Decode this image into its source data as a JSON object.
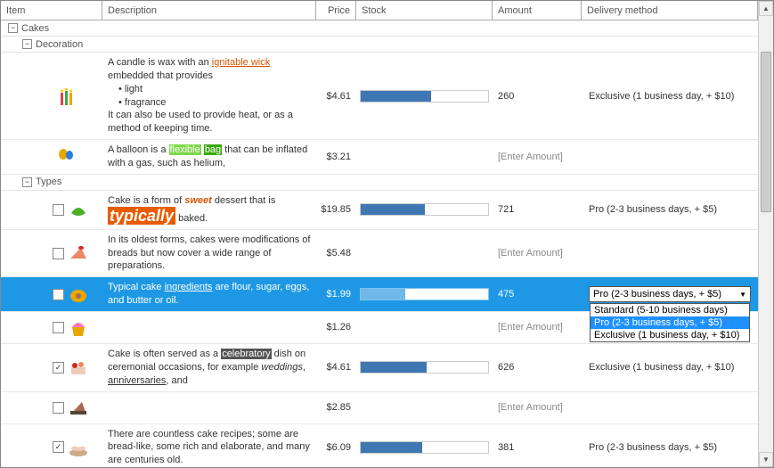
{
  "headers": {
    "item": "Item",
    "desc": "Description",
    "price": "Price",
    "stock": "Stock",
    "amount": "Amount",
    "delivery": "Delivery method"
  },
  "groups": {
    "cakes": "Cakes",
    "decoration": "Decoration",
    "types": "Types"
  },
  "placeholder": "[Enter Amount]",
  "rows": {
    "candle": {
      "price": "$4.61",
      "amount": "260",
      "delivery": "Exclusive (1 business day, + $10)",
      "stock_pct": 55,
      "desc_pre": "A candle is wax with an ",
      "desc_link": "ignitable wick",
      "desc_post": " embedded that provides",
      "b1": "light",
      "b2": "fragrance",
      "desc_tail": "It can also be used to provide heat, or as a method of keeping time."
    },
    "balloon": {
      "price": "$3.21",
      "desc_pre": "A balloon is a ",
      "hl1": "flexible",
      "mid": " ",
      "hl2": "bag",
      "desc_post": " that can be inflated with a gas, such as helium,"
    },
    "sweet": {
      "price": "$19.85",
      "amount": "721",
      "delivery": "Pro (2-3 business days, + $5)",
      "stock_pct": 50,
      "d1": "Cake is a form of ",
      "d2": "sweet ",
      "d3": "dessert that is ",
      "d4": "typically",
      "d5": " baked."
    },
    "oldest": {
      "price": "$5.48",
      "desc": "In its oldest forms, cakes were modifications of breads but now cover a wide range of preparations."
    },
    "ingr": {
      "price": "$1.99",
      "amount": "475",
      "stock_pct": 35,
      "d1": "Typical cake ",
      "d2": "ingredients",
      "d3": " are flour, sugar, eggs, and butter or oil.",
      "combo": "Pro (2-3 business days, + $5)",
      "opts": [
        "Standard (5-10 business days)",
        "Pro (2-3 business days, + $5)",
        "Exclusive (1 business day, + $10)"
      ]
    },
    "cupcake": {
      "price": "$1.26"
    },
    "celeb": {
      "price": "$4.61",
      "amount": "626",
      "delivery": "Exclusive (1 business day, + $10)",
      "stock_pct": 52,
      "d1": "Cake is often served as a ",
      "d2": "celebratory",
      "d3": " dish on ceremonial occasions, for example ",
      "d4": "weddings",
      "d5": ", ",
      "d6": "anniversaries",
      "d7": ", and"
    },
    "empty": {
      "price": "$2.85"
    },
    "countless": {
      "price": "$6.09",
      "amount": "381",
      "delivery": "Pro (2-3 business days, + $5)",
      "stock_pct": 48,
      "desc": "There are countless cake recipes; some are bread-like, some rich and elaborate, and many are centuries old."
    }
  },
  "chart_data": {
    "type": "table",
    "note": "Stock column renders horizontal progress bars; values are approximate fill percentages read from pixel widths.",
    "series": [
      {
        "name": "stock_fill_pct",
        "categories": [
          "candle",
          "sweet",
          "ingr",
          "celeb",
          "countless"
        ],
        "values": [
          55,
          50,
          35,
          52,
          48
        ]
      }
    ]
  }
}
